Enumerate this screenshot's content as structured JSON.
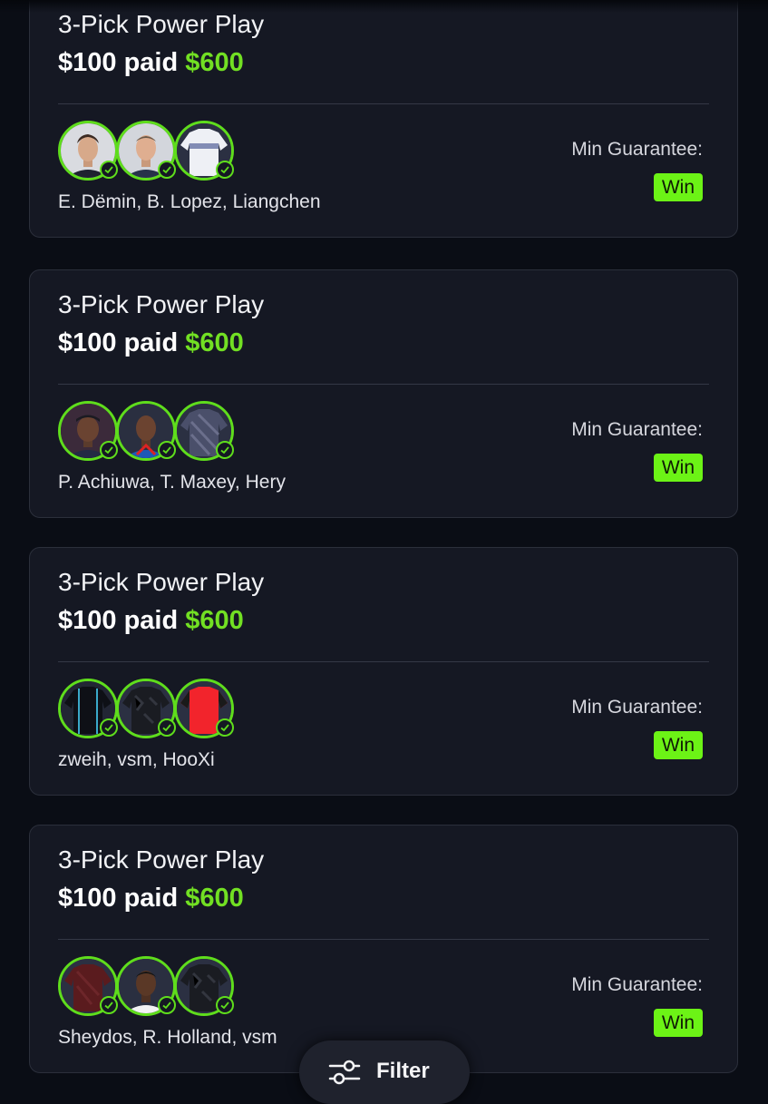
{
  "entries": [
    {
      "title": "3-Pick Power Play",
      "paid_text": "$100 paid",
      "payout": "$600",
      "players": "E. Dëmin, B. Lopez, Liangchen",
      "guarantee_label": "Min Guarantee:",
      "result": "Win",
      "picks": [
        {
          "name": "E. Dëmin",
          "avatar": "player-headshot-icon",
          "status": "checkmark-icon"
        },
        {
          "name": "B. Lopez",
          "avatar": "player-headshot-icon",
          "status": "checkmark-icon"
        },
        {
          "name": "Liangchen",
          "avatar": "jersey-icon",
          "status": "checkmark-icon"
        }
      ]
    },
    {
      "title": "3-Pick Power Play",
      "paid_text": "$100 paid",
      "payout": "$600",
      "players": "P. Achiuwa, T. Maxey, Hery",
      "guarantee_label": "Min Guarantee:",
      "result": "Win",
      "picks": [
        {
          "name": "P. Achiuwa",
          "avatar": "player-headshot-icon",
          "status": "checkmark-icon"
        },
        {
          "name": "T. Maxey",
          "avatar": "player-headshot-icon",
          "status": "checkmark-icon"
        },
        {
          "name": "Hery",
          "avatar": "jersey-icon",
          "status": "checkmark-icon"
        }
      ]
    },
    {
      "title": "3-Pick Power Play",
      "paid_text": "$100 paid",
      "payout": "$600",
      "players": "zweih, vsm, HooXi",
      "guarantee_label": "Min Guarantee:",
      "result": "Win",
      "picks": [
        {
          "name": "zweih",
          "avatar": "jersey-icon",
          "status": "checkmark-icon"
        },
        {
          "name": "vsm",
          "avatar": "jersey-icon",
          "status": "checkmark-icon"
        },
        {
          "name": "HooXi",
          "avatar": "jersey-icon",
          "status": "checkmark-icon"
        }
      ]
    },
    {
      "title": "3-Pick Power Play",
      "paid_text": "$100 paid",
      "payout": "$600",
      "players": "Sheydos, R. Holland, vsm",
      "guarantee_label": "Min Guarantee:",
      "result": "Win",
      "picks": [
        {
          "name": "Sheydos",
          "avatar": "jersey-icon",
          "status": "checkmark-icon"
        },
        {
          "name": "R. Holland",
          "avatar": "player-headshot-icon",
          "status": "checkmark-icon"
        },
        {
          "name": "vsm",
          "avatar": "jersey-icon",
          "status": "checkmark-icon"
        }
      ]
    }
  ],
  "filter": {
    "label": "Filter",
    "icon": "sliders-icon"
  },
  "colors": {
    "background": "#0a0d15",
    "card": "#151823",
    "accent_green": "#72e023",
    "win_badge": "#6cf316"
  }
}
